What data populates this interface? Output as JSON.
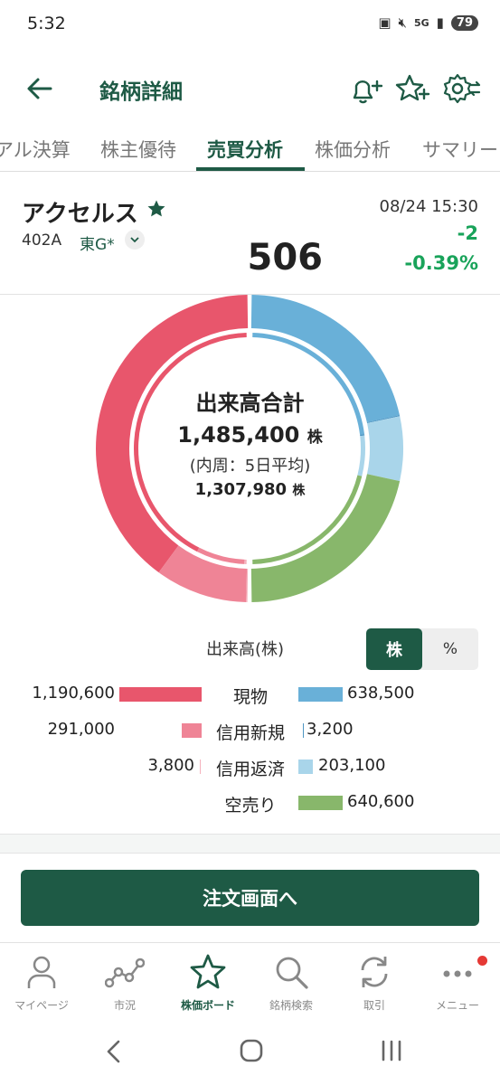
{
  "status": {
    "time": "5:32",
    "battery": "79",
    "network": "5G"
  },
  "header": {
    "title": "銘柄詳細"
  },
  "tabs": [
    "アル決算",
    "株主優待",
    "売買分析",
    "株価分析",
    "サマリー"
  ],
  "stock": {
    "name": "アクセルス",
    "code": "402A",
    "market": "東G*",
    "price": "506",
    "datetime": "08/24 15:30",
    "change": "-2",
    "change_pct": "-0.39%"
  },
  "donut_center": {
    "title": "出来高合計",
    "total": "1,485,400",
    "unit": "株",
    "sub": "(内周：5日平均)",
    "avg": "1,307,980"
  },
  "legend": {
    "title": "出来高(株)",
    "toggle_stock": "株",
    "toggle_pct": "%",
    "rows": [
      {
        "label": "現物",
        "left": "1,190,600",
        "right": "638,500"
      },
      {
        "label": "信用新規",
        "left": "291,000",
        "right": "3,200"
      },
      {
        "label": "信用返済",
        "left": "3,800",
        "right": "203,100"
      },
      {
        "label": "空売り",
        "left": "",
        "right": "640,600"
      }
    ]
  },
  "chart_data": {
    "type": "pie",
    "title": "出来高合計",
    "unit": "株",
    "buy_side": [
      {
        "name": "現物",
        "value": 1190600
      },
      {
        "name": "信用新規",
        "value": 291000
      },
      {
        "name": "信用返済",
        "value": 3800
      }
    ],
    "sell_side": [
      {
        "name": "現物",
        "value": 638500
      },
      {
        "name": "信用新規",
        "value": 3200
      },
      {
        "name": "信用返済",
        "value": 203100
      },
      {
        "name": "空売り",
        "value": 640600
      }
    ],
    "colors": {
      "buy_spot": "#e8566c",
      "buy_margin_new": "#ef8496",
      "buy_margin_repay": "#f5b2bd",
      "sell_spot": "#69b0d8",
      "sell_margin_new": "#4e96c3",
      "sell_margin_repay": "#a9d5ea",
      "short": "#88b76b"
    }
  },
  "order_button": "注文画面へ",
  "bottom_nav": [
    "マイページ",
    "市況",
    "株価ボード",
    "銘柄検索",
    "取引",
    "メニュー"
  ],
  "colors": {
    "brand": "#1e5a45",
    "positive": "#19a35a",
    "alert_dot": "#e53935"
  }
}
